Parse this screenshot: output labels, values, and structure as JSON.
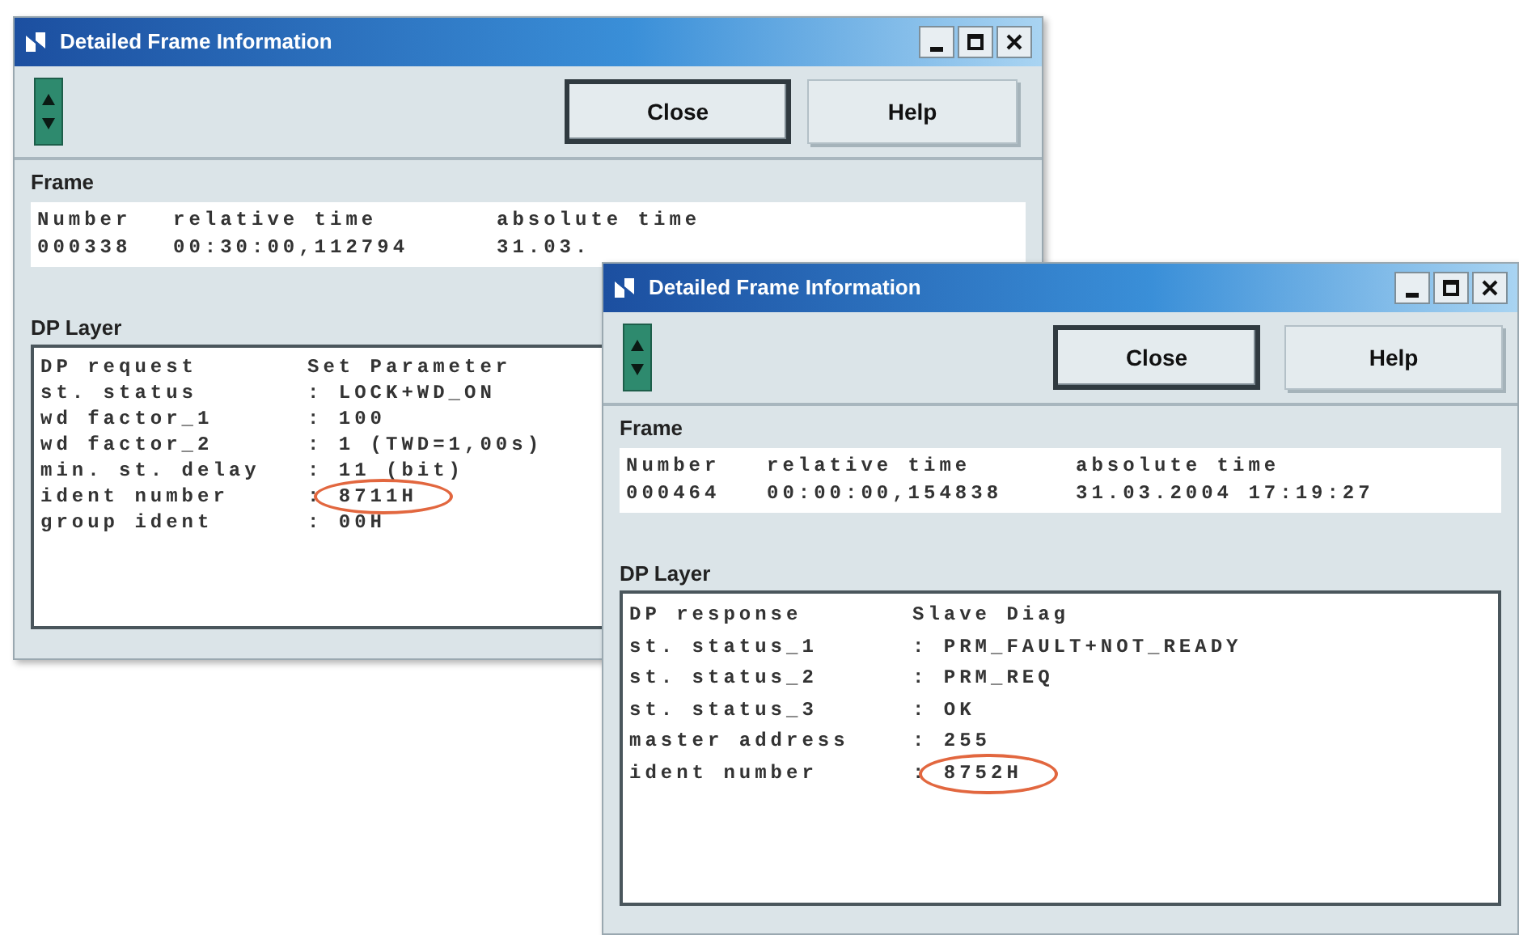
{
  "windows": [
    {
      "title": "Detailed Frame Information",
      "buttons": [
        {
          "label": "Close",
          "default": true
        },
        {
          "label": "Help",
          "default": false
        }
      ],
      "frame": {
        "heading": "Frame",
        "columns": [
          "Number",
          "relative time",
          "absolute time"
        ],
        "values": [
          "000338",
          "00:30:00,112794",
          "31.03."
        ]
      },
      "dp_layer": {
        "heading": "DP Layer",
        "rows": [
          {
            "label": "DP request",
            "value": "Set Parameter",
            "highlighted": false
          },
          {
            "label": "st. status",
            "value": ": LOCK+WD_ON",
            "highlighted": false
          },
          {
            "label": "wd factor_1",
            "value": ": 100",
            "highlighted": false
          },
          {
            "label": "wd factor_2",
            "value": ": 1 (TWD=1,00s)",
            "highlighted": false
          },
          {
            "label": "min. st. delay",
            "value": ": 11 (bit)",
            "highlighted": false
          },
          {
            "label": "ident number",
            "value": ": 8711H",
            "highlighted": true
          },
          {
            "label": "group ident",
            "value": ": 00H",
            "highlighted": false
          }
        ]
      }
    },
    {
      "title": "Detailed Frame Information",
      "buttons": [
        {
          "label": "Close",
          "default": true
        },
        {
          "label": "Help",
          "default": false
        }
      ],
      "frame": {
        "heading": "Frame",
        "columns": [
          "Number",
          "relative time",
          "absolute time"
        ],
        "values": [
          "000464",
          "00:00:00,154838",
          "31.03.2004 17:19:27"
        ]
      },
      "dp_layer": {
        "heading": "DP Layer",
        "rows": [
          {
            "label": "DP response",
            "value": "Slave Diag",
            "highlighted": false
          },
          {
            "label": "st. status_1",
            "value": ": PRM_FAULT+NOT_READY",
            "highlighted": false
          },
          {
            "label": "st. status_2",
            "value": ": PRM_REQ",
            "highlighted": false
          },
          {
            "label": "st. status_3",
            "value": ": OK",
            "highlighted": false
          },
          {
            "label": "master address",
            "value": ": 255",
            "highlighted": false
          },
          {
            "label": "ident number",
            "value": ": 8752H",
            "highlighted": true
          }
        ]
      }
    }
  ]
}
